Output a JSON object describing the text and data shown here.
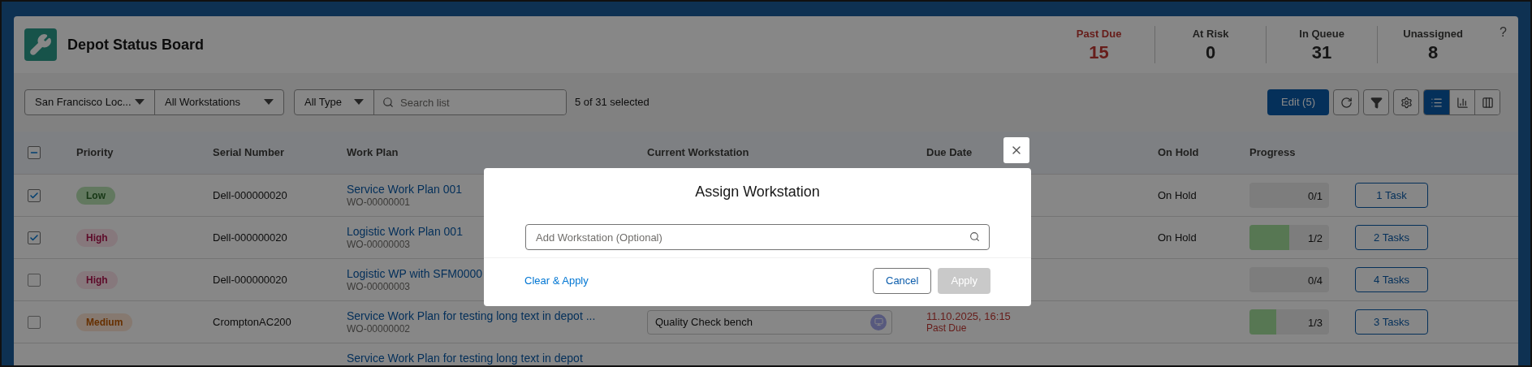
{
  "app": {
    "title": "Depot Status Board"
  },
  "stats": [
    {
      "label": "Past Due",
      "value": "15",
      "kind": "alert"
    },
    {
      "label": "At Risk",
      "value": "0",
      "kind": "normal"
    },
    {
      "label": "In Queue",
      "value": "31",
      "kind": "normal"
    },
    {
      "label": "Unassigned",
      "value": "8",
      "kind": "normal"
    }
  ],
  "help": "?",
  "toolbar": {
    "location_filter": "San Francisco Loc...",
    "workstation_filter": "All Workstations",
    "type_filter": "All Type",
    "search": {
      "placeholder": "Search list"
    },
    "selection_count": "5 of 31 selected",
    "edit_button": "Edit (5)",
    "views": [
      {
        "kind": "list",
        "selected": true
      },
      {
        "kind": "chart",
        "selected": false
      },
      {
        "kind": "columns",
        "selected": false
      }
    ]
  },
  "table": {
    "select_all": {
      "indeterminate": true
    },
    "columns": [
      "Priority",
      "Serial Number",
      "Work Plan",
      "Current Workstation",
      "Due Date",
      "On Hold",
      "Progress"
    ],
    "rows": [
      {
        "selected": true,
        "priority": {
          "label": "Low",
          "kind": "low"
        },
        "serial": "Dell-000000020",
        "work_plan": "Service Work Plan 001",
        "work_order": "WO-00000001",
        "on_hold": "On Hold",
        "progress": {
          "level": 0,
          "text": "0/1"
        },
        "tasks": "1 Task"
      },
      {
        "selected": true,
        "priority": {
          "label": "High",
          "kind": "high"
        },
        "serial": "Dell-000000020",
        "work_plan": "Logistic Work Plan 001",
        "work_order": "WO-00000003",
        "on_hold": "On Hold",
        "progress": {
          "level": 0.5,
          "text": "1/2"
        },
        "tasks": "2 Tasks"
      },
      {
        "selected": false,
        "priority": {
          "label": "High",
          "kind": "high"
        },
        "serial": "Dell-000000020",
        "work_plan": "Logistic WP with SFM0000",
        "work_order": "WO-00000003",
        "progress": {
          "level": 0,
          "text": "0/4"
        },
        "tasks": "4 Tasks"
      },
      {
        "selected": false,
        "priority": {
          "label": "Medium",
          "kind": "medium"
        },
        "serial": "CromptonAC200",
        "work_plan": "Service Work Plan for testing long text in depot ...",
        "work_order": "WO-00000002",
        "workstation": "Quality Check bench",
        "due_date": "11.10.2025, 16:15",
        "due_status": "Past Due",
        "progress": {
          "level": 0.333,
          "text": "1/3"
        },
        "tasks": "3 Tasks"
      },
      {
        "work_plan": "Service Work Plan for testing long text in depot"
      }
    ]
  },
  "dialog": {
    "title": "Assign Workstation",
    "field": {
      "placeholder": "Add Workstation (Optional)"
    },
    "clear_link": "Clear & Apply",
    "cancel": "Cancel",
    "apply": {
      "label": "Apply",
      "disabled": true
    }
  }
}
